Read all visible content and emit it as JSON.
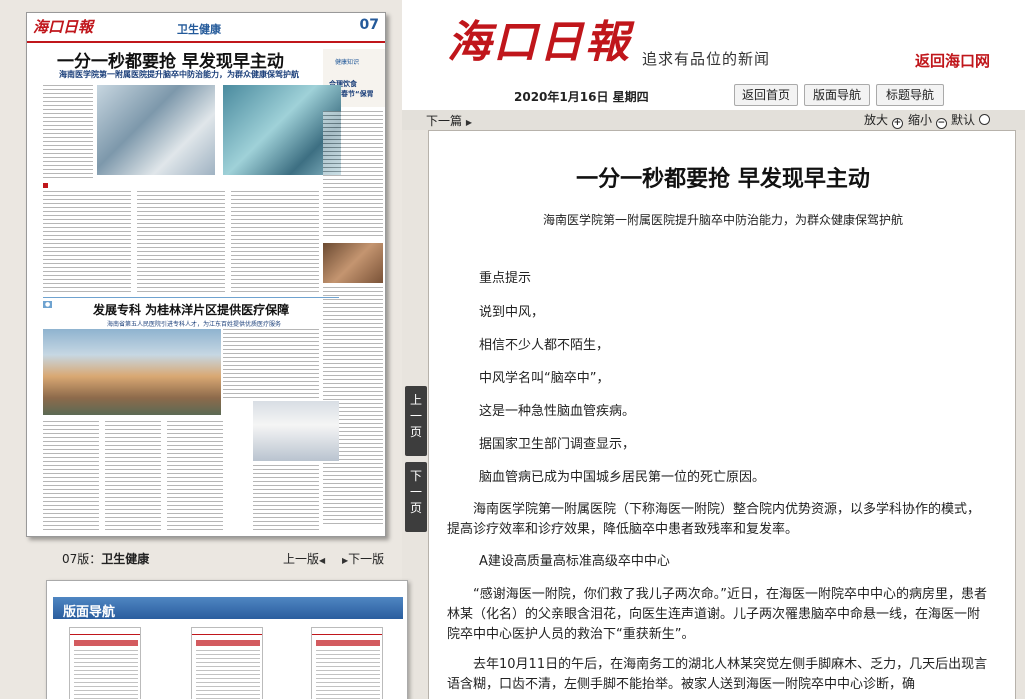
{
  "masthead": {
    "logo_chars": [
      "海",
      "口",
      "日",
      "報"
    ],
    "slogan": "追求有品位的新闻",
    "back_link": "返回海口网"
  },
  "date": "2020年1月16日 星期四",
  "tabs": [
    "返回首页",
    "版面导航",
    "标题导航"
  ],
  "toolbar": {
    "next_article": "下一篇",
    "zoom_in": "放大",
    "zoom_out": "缩小",
    "default": "默认"
  },
  "paper": {
    "logo": "海口日報",
    "section": "卫生健康",
    "page_num": "07",
    "headline": "一分一秒都要抢 早发现早主动",
    "sub": "海南医学院第一附属医院提升脑卒中防治能力，为群众健康保驾护航",
    "side_title_small": "健康知识",
    "side_title_1": "合理饮食",
    "side_title_2": "开启春节“保胃战”",
    "headline2": "发展专科 为桂林洋片区提供医疗保障",
    "sub2": "海南省第五人民医院引进专科人才，为江东百姓提供优质医疗服务"
  },
  "page_info": {
    "page_label": "07版：",
    "section_name": "卫生健康",
    "prev": "上一版",
    "next": "下一版"
  },
  "side_buttons": {
    "prev": [
      "上",
      "一",
      "页"
    ],
    "next": [
      "下",
      "一",
      "页"
    ]
  },
  "nav_panel": {
    "title": "版面导航"
  },
  "article": {
    "title": "一分一秒都要抢 早发现早主动",
    "subtitle": "海南医学院第一附属医院提升脑卒中防治能力，为群众健康保驾护航",
    "paragraphs": [
      "重点提示",
      "说到中风，",
      "相信不少人都不陌生，",
      "中风学名叫“脑卒中”，",
      "这是一种急性脑血管疾病。",
      "据国家卫生部门调查显示，",
      "脑血管病已成为中国城乡居民第一位的死亡原因。",
      "海南医学院第一附属医院（下称海医一附院）整合院内优势资源，以多学科协作的模式，提高诊疗效率和诊疗效果，降低脑卒中患者致残率和复发率。",
      "A建设高质量高标准高级卒中中心",
      "“感谢海医一附院，你们救了我儿子两次命。”近日，在海医一附院卒中中心的病房里，患者林某（化名）的父亲眼含泪花，向医生连声道谢。儿子两次罹患脑卒中命悬一线，在海医一附院卒中中心医护人员的救治下“重获新生”。",
      "去年10月11日的午后，在海南务工的湖北人林某突觉左侧手脚麻木、乏力，几天后出现言语含糊，口齿不清，左侧手脚不能抬举。被家人送到海医一附院卒中中心诊断，确"
    ]
  }
}
